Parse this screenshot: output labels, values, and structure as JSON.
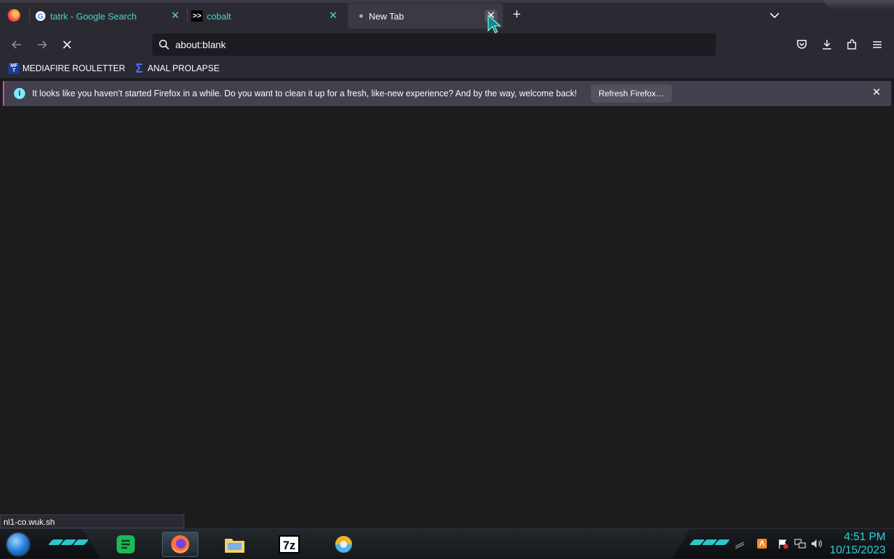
{
  "tabs": [
    {
      "title": "tatrk - Google Search",
      "favicon": "google-icon",
      "active": false
    },
    {
      "title": "cobalt",
      "favicon": "cobalt-icon",
      "active": false
    },
    {
      "title": "New Tab",
      "favicon": "loading-dot-icon",
      "active": true
    }
  ],
  "urlbar": {
    "value": "about:blank"
  },
  "bookmarks": [
    {
      "label": "MEDIAFIRE ROULETTER",
      "icon": "mediafire-icon"
    },
    {
      "label": "ANAL PROLAPSE",
      "icon": "sigma-icon"
    }
  ],
  "notification": {
    "message": "It looks like you haven’t started Firefox in a while. Do you want to clean it up for a fresh, like-new experience? And by the way, welcome back!",
    "button_label": "Refresh Firefox…"
  },
  "status_url": "nl1-co.wuk.sh",
  "clock": {
    "time": "4:51 PM",
    "date": "10/15/2023"
  },
  "bookmark_icon_text": {
    "mediafire": "MF T",
    "sigma": "Σ"
  },
  "taskbar_7z_label": "7z",
  "colors": {
    "accent": "#2fd3de",
    "tab_close": "#4fd1c5",
    "notice_border": "#e24a9d"
  }
}
